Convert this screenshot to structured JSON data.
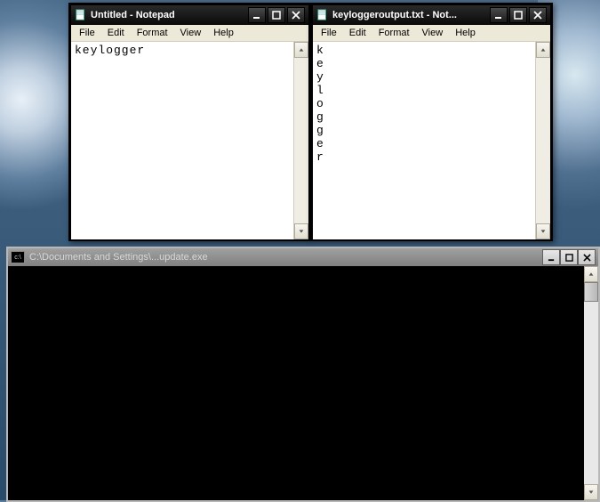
{
  "windows": {
    "notepad1": {
      "title": "Untitled - Notepad",
      "menu": [
        "File",
        "Edit",
        "Format",
        "View",
        "Help"
      ],
      "content": "keylogger"
    },
    "notepad2": {
      "title": "keyloggeroutput.txt - Not...",
      "menu": [
        "File",
        "Edit",
        "Format",
        "View",
        "Help"
      ],
      "content": "k\ne\ny\nl\no\ng\ng\ne\nr"
    },
    "cmd": {
      "title": "C:\\Documents and Settings\\...update.exe",
      "icon_label": "c:\\"
    }
  }
}
